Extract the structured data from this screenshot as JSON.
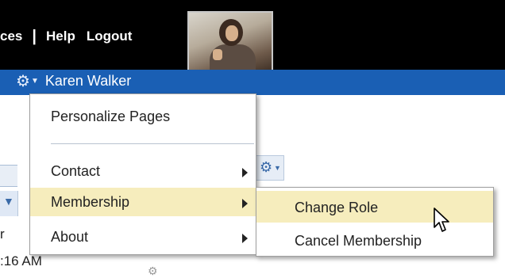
{
  "topbar": {
    "partial_link": "ces",
    "help_label": "Help",
    "logout_label": "Logout"
  },
  "user": {
    "name": "Karen Walker",
    "gear_icon": "⚙",
    "caret": "▼"
  },
  "menu": {
    "items": [
      {
        "label": "Personalize Pages"
      },
      {
        "label": "Contact"
      },
      {
        "label": "Membership"
      },
      {
        "label": "About"
      }
    ]
  },
  "submenu": {
    "items": [
      {
        "label": "Change Role"
      },
      {
        "label": "Cancel Membership"
      }
    ]
  },
  "background": {
    "letter": "r",
    "time": ":16 AM"
  },
  "colors": {
    "topbar": "#000000",
    "bluebar": "#1a5fb4",
    "highlight": "#f6edbd"
  }
}
